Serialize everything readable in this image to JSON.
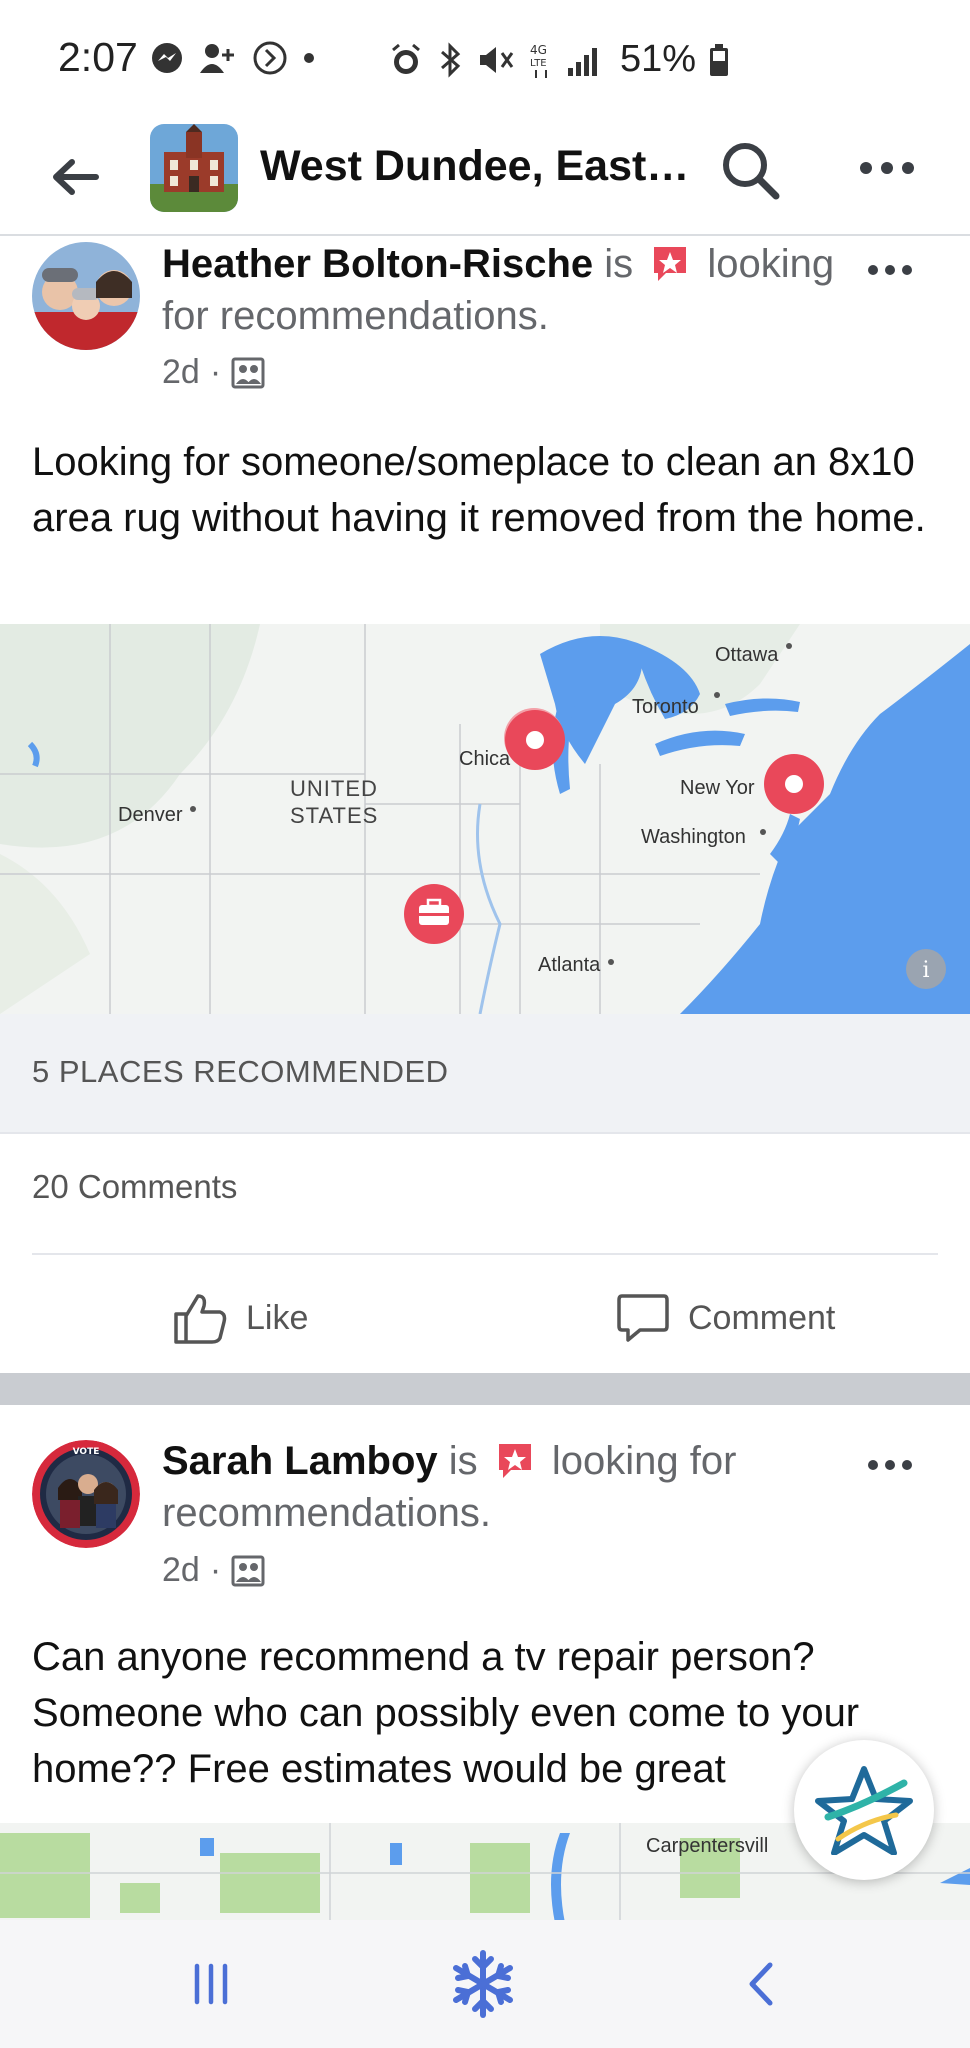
{
  "status_bar": {
    "time": "2:07",
    "battery_text": "51%",
    "icons": [
      "messenger-icon",
      "person-add-icon",
      "do-not-disturb-icon",
      "dot-icon",
      "alarm-icon",
      "bluetooth-icon",
      "mute-icon",
      "4g-lte-icon",
      "signal-icon",
      "battery-icon"
    ]
  },
  "nav": {
    "title": "West Dundee, East…",
    "back_icon": "arrow-left-icon",
    "search_icon": "search-icon",
    "more_icon": "more-dots-icon"
  },
  "posts": [
    {
      "author": "Heather Bolton-Rische",
      "pre_badge": " is ",
      "status": " looking for recommendations.",
      "time": "2d",
      "privacy_icon": "group-privacy-icon",
      "text": "Looking for someone/someplace to clean an 8x10 area rug without having it removed from the home.",
      "map_labels": [
        "Ottawa",
        "Toronto",
        "Chica",
        "New Yor",
        "Washington",
        "Denver",
        "UNITED",
        "STATES",
        "Atlanta"
      ],
      "places_recommended": "5 PLACES RECOMMENDED",
      "comments": "20 Comments",
      "like_label": "Like",
      "comment_label": "Comment"
    },
    {
      "author": "Sarah Lamboy",
      "pre_badge": " is ",
      "status": " looking for recommendations.",
      "time": "2d",
      "privacy_icon": "group-privacy-icon",
      "text": "Can anyone recommend a tv repair person? Someone who can possibly even come to your home?? Free estimates would be great",
      "map_labels": [
        "Carpentersvill"
      ]
    }
  ],
  "colors": {
    "accent_red": "#e9485a",
    "water": "#5c9ded",
    "nav_blue": "#4b6fd6"
  },
  "bottom_nav": {
    "recents_icon": "recent-apps-icon",
    "home_icon": "snowflake-home-icon",
    "back_icon": "nav-back-icon"
  }
}
